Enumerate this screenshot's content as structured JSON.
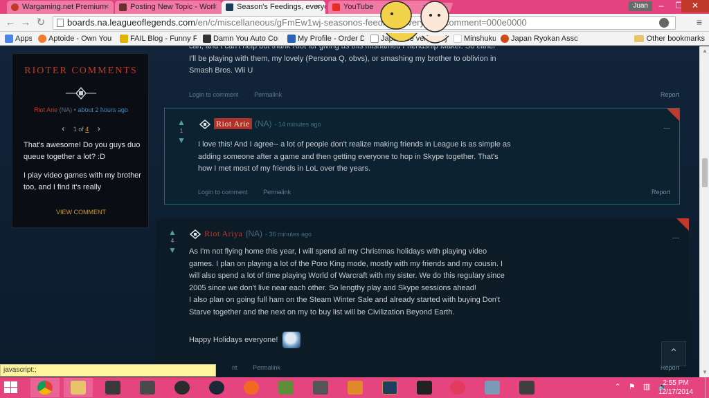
{
  "browser": {
    "tabs": [
      {
        "title": "Wargaming.net Premium",
        "icon_color": "#c0392b"
      },
      {
        "title": "Posting New Topic - Worl",
        "icon_color": "#6b2f2f"
      },
      {
        "title": "Season's Feedings, everyo",
        "icon_color": "#1b3b57",
        "active": true
      },
      {
        "title": "YouTube",
        "icon_color": "#e52d27"
      }
    ],
    "user": "Juan",
    "url_host": "boards.na.leagueoflegends.com",
    "url_path": "/en/c/miscellaneous/gFmEw1wj-seasonos-feedings-everyone?comment=000e0000",
    "bookmarks": [
      {
        "label": "Apps",
        "icon_color": "#4a86e8"
      },
      {
        "label": "Aptoide - Own Your...",
        "icon_color": "#f07a2d"
      },
      {
        "label": "FAIL Blog - Funny F...",
        "icon_color": "#e0b400"
      },
      {
        "label": "Damn You Auto Cor...",
        "icon_color": "#333333"
      },
      {
        "label": "My Profile - Order D...",
        "icon_color": "#2a63b8"
      },
      {
        "label": "Japanese verb conju...",
        "icon_color": "#555555"
      },
      {
        "label": "Minshuku",
        "icon_color": "#d71a21"
      },
      {
        "label": "Japan Ryokan Assoc...",
        "icon_color": "#d04a1a"
      }
    ],
    "other_bookmarks": "Other bookmarks",
    "status_url": "javascript:;"
  },
  "sidebar": {
    "title": "RIOTER COMMENTS",
    "author": "Riot Arie",
    "region": "(NA)",
    "separator": "•",
    "time": "about 2 hours ago",
    "pager": {
      "current": "1",
      "of": "of",
      "total": "4"
    },
    "comment_lines": [
      "That's awesome! Do you guys duo queue together a lot? :D",
      "I play video games with my brother too, and I find it's really"
    ],
    "view_link": "VIEW COMMENT"
  },
  "top_comment": {
    "lines": [
      "can, and I can't help but thank Riot for giving us this misnamed Friendship Maker. So either",
      "I'll be playing with them, my lovely (Persona Q, obvs), or smashing my brother to oblivion in",
      "Smash Bros. Wii U"
    ],
    "login": "Login to comment",
    "permalink": "Permalink",
    "report": "Report"
  },
  "comment_arie": {
    "votes": "1",
    "author": "Riot Arie",
    "region": "(NA)",
    "ago": "- 14 minutes ago",
    "lines": [
      "I love this! And I agree-- a lot of people don't realize making friends in League is as simple as",
      "adding someone after a game and then getting everyone to hop in Skype together. That's",
      "how I met most of my friends in LoL over the years."
    ],
    "login": "Login to comment",
    "permalink": "Permalink",
    "report": "Report"
  },
  "comment_ariya": {
    "votes": "4",
    "author": "Riot Ariya",
    "region": "(NA)",
    "ago": "- 36 minutes ago",
    "lines": [
      "As I'm not flying home this year, I will spend all my Christmas holidays with playing video",
      "games. I plan on playing a lot of the Poro King mode, mostly with my friends and my cousin. I",
      "will also spend a lot of time playing World of Warcraft with my sister. We do this regulary since",
      "2005 since we don't live near each other. So lengthy play and Skype sessions ahead!",
      "I also plan on going full ham on the Steam Winter Sale and already started with buying Don't",
      "Starve together and the next on my to buy list will be Civilization Beyond Earth."
    ],
    "closing": "Happy Holidays everyone!",
    "login": "nt",
    "permalink": "Permalink",
    "report": "Report"
  },
  "taskbar": {
    "apps": [
      {
        "name": "chrome",
        "color": "#4a9a3a"
      },
      {
        "name": "file-explorer",
        "color": "#e8c46a"
      },
      {
        "name": "world-of-tanks",
        "color": "#3a3a3a"
      },
      {
        "name": "world-of-tanks-2",
        "color": "#4a4a4a"
      },
      {
        "name": "obs",
        "color": "#2b2b2b"
      },
      {
        "name": "steam",
        "color": "#1b2838"
      },
      {
        "name": "origin",
        "color": "#f26a21"
      },
      {
        "name": "minecraft",
        "color": "#5d8f3a"
      },
      {
        "name": "notepad-app",
        "color": "#555555"
      },
      {
        "name": "game-app",
        "color": "#e08a2a"
      },
      {
        "name": "league-of-legends",
        "color": "#1f3f5f"
      },
      {
        "name": "guild-wars",
        "color": "#222222"
      },
      {
        "name": "itunes",
        "color": "#e23b5f"
      },
      {
        "name": "photo-app",
        "color": "#7a9ab8"
      },
      {
        "name": "world-of-tanks-3",
        "color": "#3f3f3f"
      }
    ],
    "time": "2:55 PM",
    "date": "12/17/2014"
  }
}
